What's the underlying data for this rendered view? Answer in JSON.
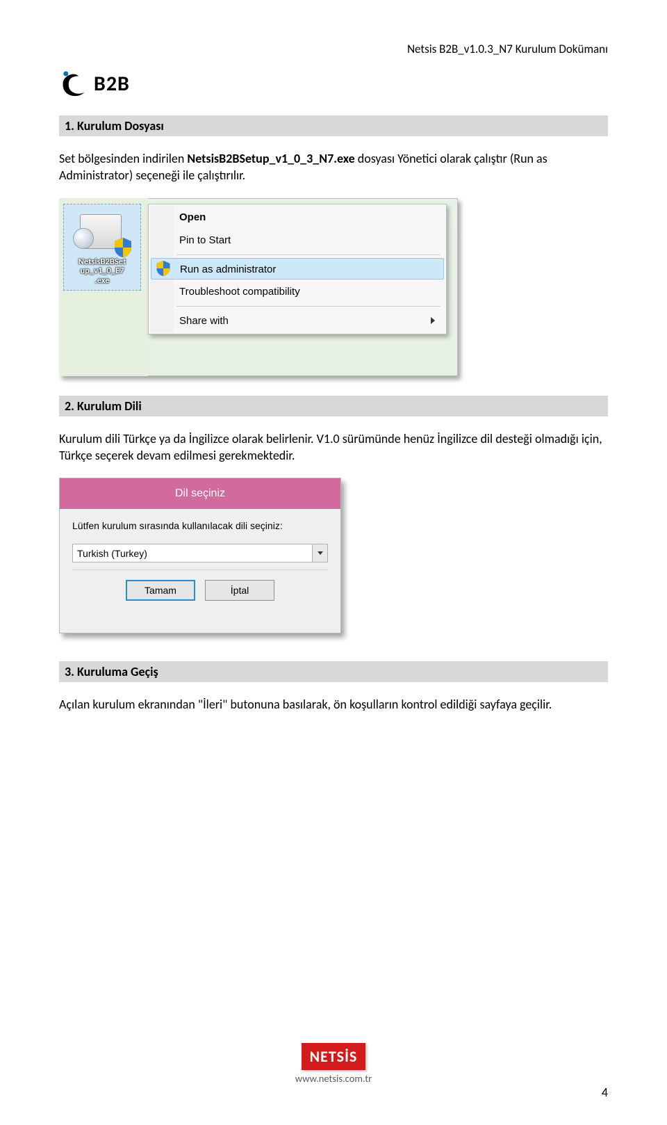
{
  "header": {
    "doc_title": "Netsis B2B_v1.0.3_N7 Kurulum Dokümanı"
  },
  "logo": {
    "text": "B2B"
  },
  "sections": {
    "s1_title": "1.  Kurulum Dosyası",
    "s1_body_pre": "Set bölgesinden indirilen ",
    "s1_body_bold": "NetsisB2BSetup_v1_0_3_N7.exe",
    "s1_body_post": " dosyası Yönetici olarak çalıştır (Run as Administrator) seçeneği ile çalıştırılır.",
    "s2_title": "2.  Kurulum Dili",
    "s2_body": "Kurulum dili Türkçe ya da İngilizce olarak belirlenir. V1.0 sürümünde henüz İngilizce dil desteği olmadığı için, Türkçe seçerek devam edilmesi gerekmektedir.",
    "s3_title": "3.  Kuruluma Geçiş",
    "s3_body": "Açılan kurulum ekranından \"İleri\" butonuna basılarak, ön koşulların kontrol edildiği sayfaya geçilir."
  },
  "ctx_shot": {
    "exe_label_l1": "NetsisB2BSet",
    "exe_label_l2": "up_v1_0_E7",
    "exe_label_l3": ".exe",
    "items": {
      "open": "Open",
      "pin": "Pin to Start",
      "runas": "Run as administrator",
      "troubleshoot": "Troubleshoot compatibility",
      "share": "Share with"
    }
  },
  "lang_shot": {
    "title": "Dil seçiniz",
    "prompt": "Lütfen kurulum sırasında kullanılacak dili seçiniz:",
    "selected": "Turkish (Turkey)",
    "ok": "Tamam",
    "cancel": "İptal"
  },
  "footer": {
    "brand": "NETSİS",
    "url": "www.netsis.com.tr",
    "page_number": "4"
  }
}
